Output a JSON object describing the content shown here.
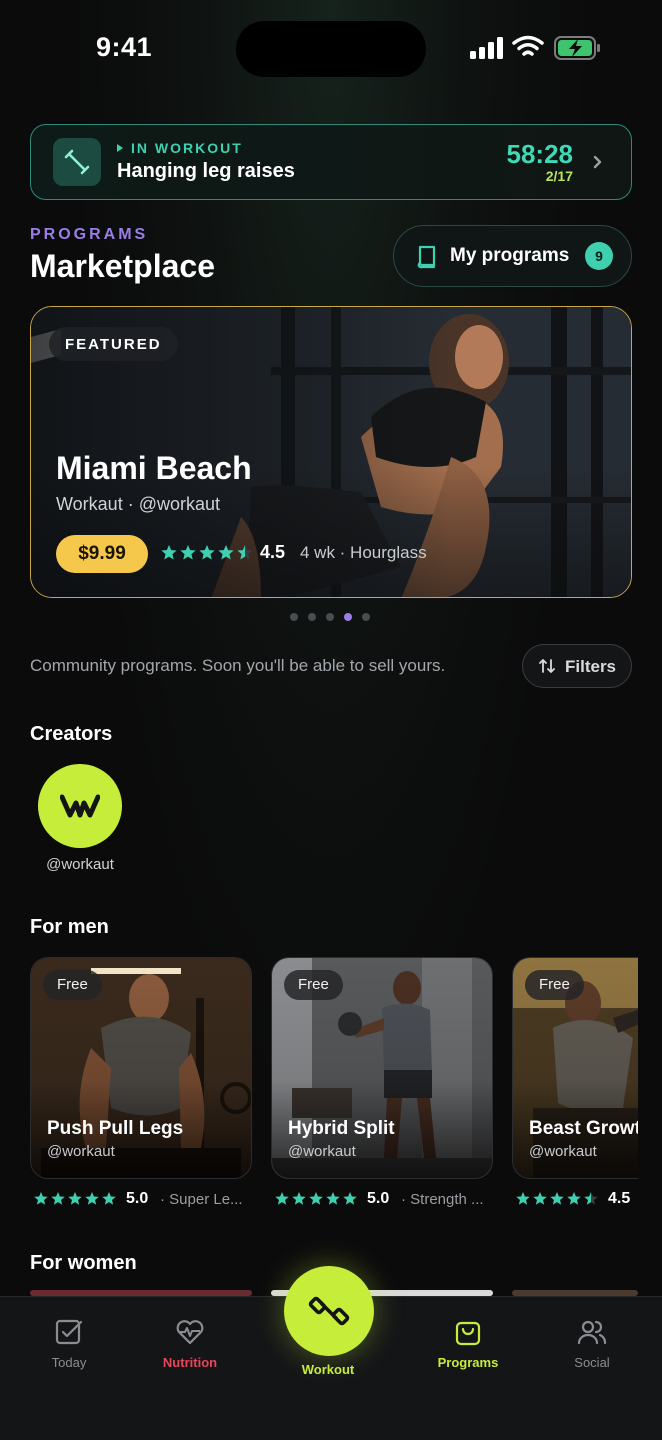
{
  "status_bar": {
    "time": "9:41"
  },
  "workout_banner": {
    "status": "IN WORKOUT",
    "exercise": "Hanging leg raises",
    "timer": "58:28",
    "progress": "2/17"
  },
  "header": {
    "overline": "PROGRAMS",
    "title": "Marketplace",
    "my_programs_label": "My programs",
    "my_programs_count": "9"
  },
  "featured": {
    "badge": "FEATURED",
    "title": "Miami Beach",
    "subtitle": "Workaut · @workaut",
    "price": "$9.99",
    "rating": "4.5",
    "rating_stars": 4.5,
    "meta": "4 wk · Hourglass",
    "pager_total": 5,
    "pager_active": 4
  },
  "community": {
    "note": "Community programs. Soon you'll be able to sell yours.",
    "filters_label": "Filters"
  },
  "creators": {
    "heading": "Creators",
    "items": [
      {
        "handle": "@workaut",
        "monogram": "W"
      }
    ]
  },
  "for_men": {
    "heading": "For men",
    "cards": [
      {
        "badge": "Free",
        "title": "Push Pull Legs",
        "handle": "@workaut",
        "rating": "5.0",
        "rating_stars": 5,
        "tag": "· Super Le..."
      },
      {
        "badge": "Free",
        "title": "Hybrid Split",
        "handle": "@workaut",
        "rating": "5.0",
        "rating_stars": 5,
        "tag": "· Strength ..."
      },
      {
        "badge": "Free",
        "title": "Beast Growt",
        "handle": "@workaut",
        "rating": "4.5",
        "rating_stars": 4.5,
        "tag": ""
      }
    ]
  },
  "for_women": {
    "heading": "For women"
  },
  "tab_bar": {
    "today": "Today",
    "nutrition": "Nutrition",
    "workout": "Workout",
    "programs": "Programs",
    "social": "Social"
  },
  "colors": {
    "accent_teal": "#3fd0b0",
    "accent_lime": "#c5ed3a",
    "accent_purple": "#9b7ee8",
    "price_gold": "#f5c84b",
    "nutrition_red": "#e8455a"
  }
}
